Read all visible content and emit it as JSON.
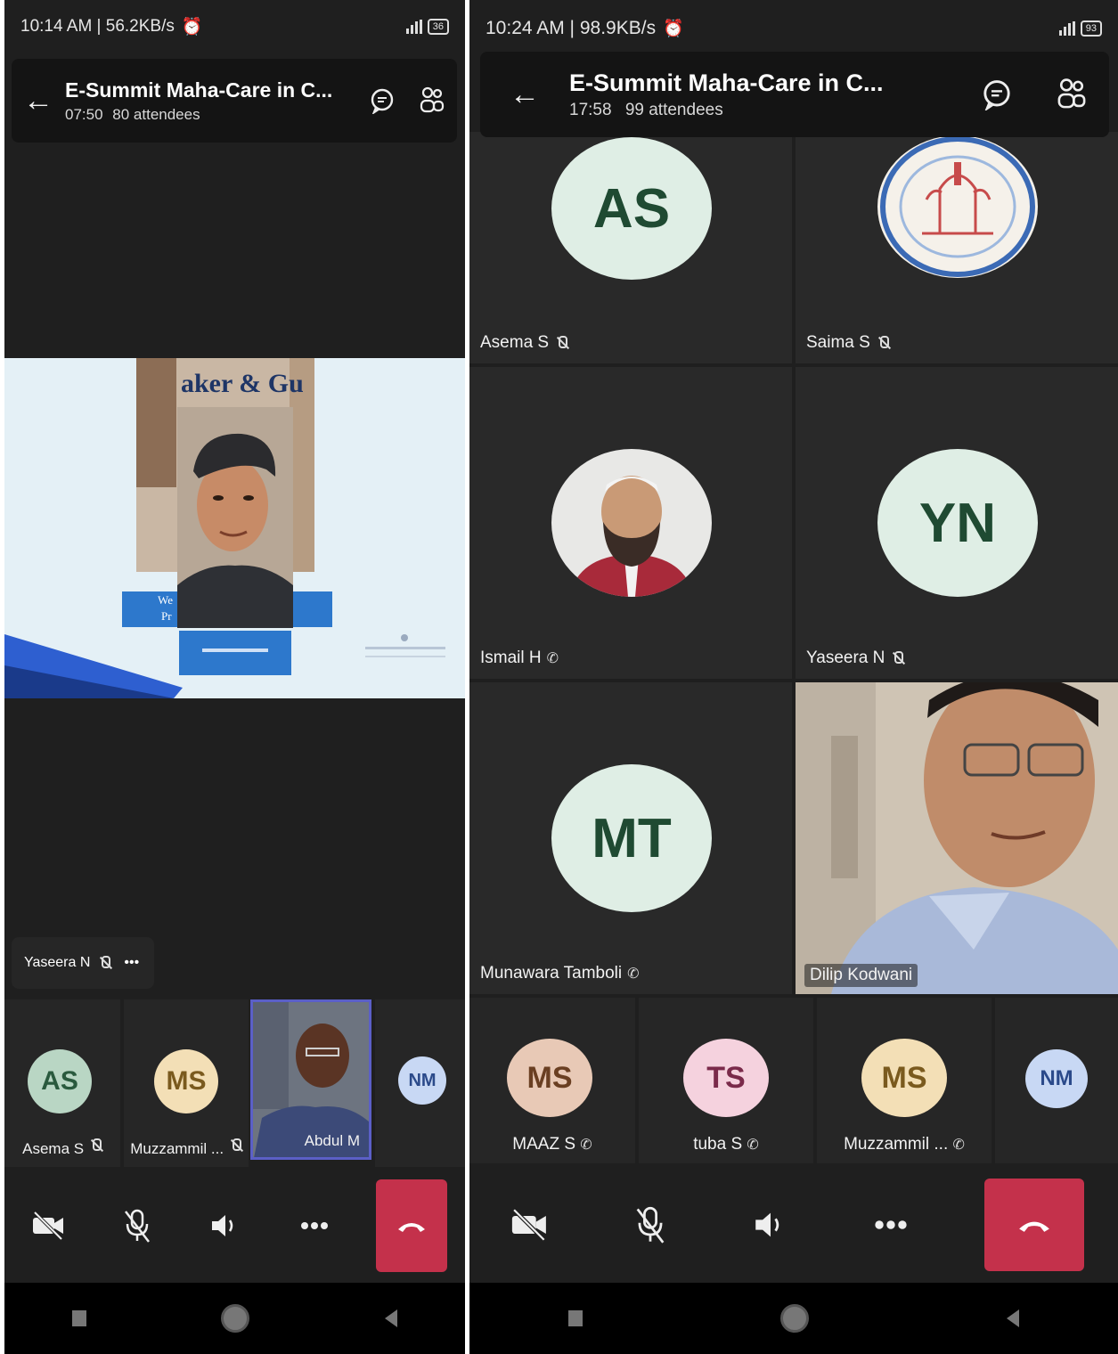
{
  "left": {
    "status": {
      "time": "10:14 AM | 56.2KB/s",
      "battery": "36"
    },
    "meeting": {
      "title": "E-Summit Maha-Care in C...",
      "duration": "07:50",
      "attendees": "80 attendees"
    },
    "slide": {
      "heading": "aker & Gu",
      "line1": "We",
      "line2": "Pr"
    },
    "caption": {
      "name": "Yaseera N",
      "more": "•••"
    },
    "strip": [
      {
        "initials": "AS",
        "name": "Asema S",
        "bg": "#b9d6c4",
        "fg": "#2a5a3e"
      },
      {
        "initials": "MS",
        "name": "Muzzammil ...",
        "bg": "#f3dfb6",
        "fg": "#7a5a1e"
      },
      {
        "name": "Abdul M"
      },
      {
        "initials": "NM",
        "bg": "#c8d8f4",
        "fg": "#2b4a8a"
      }
    ]
  },
  "right": {
    "status": {
      "time": "10:24 AM | 98.9KB/s",
      "battery": "93"
    },
    "meeting": {
      "title": "E-Summit Maha-Care in C...",
      "duration": "17:58",
      "attendees": "99 attendees"
    },
    "tiles": [
      {
        "initials": "AS",
        "name": "Asema S"
      },
      {
        "name": "Saima S"
      },
      {
        "name": "Ismail H"
      },
      {
        "initials": "YN",
        "name": "Yaseera N"
      },
      {
        "initials": "MT",
        "name": "Munawara Tamboli"
      },
      {
        "name": "Dilip Kodwani"
      }
    ],
    "strip": [
      {
        "initials": "MS",
        "name": "MAAZ S",
        "bg": "#e8c9b6",
        "fg": "#6a3f22"
      },
      {
        "initials": "TS",
        "name": "tuba S",
        "bg": "#f5d2de",
        "fg": "#7a2a4a"
      },
      {
        "initials": "MS",
        "name": "Muzzammil ...",
        "bg": "#f3dfb6",
        "fg": "#7a5a1e"
      },
      {
        "initials": "NM",
        "bg": "#c8d8f4",
        "fg": "#2b4a8a"
      }
    ]
  },
  "colors": {
    "hangup": "#c4314b",
    "avatar_mint": "#dfeee5",
    "avatar_mint_text": "#1f4a32"
  }
}
